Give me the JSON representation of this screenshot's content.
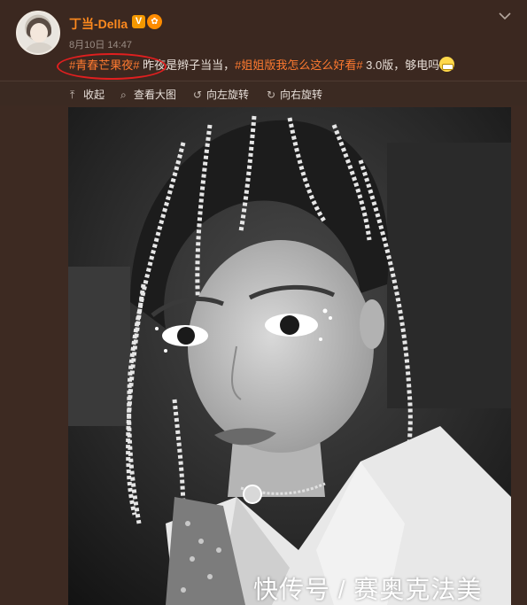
{
  "post": {
    "username": "丁当-Della",
    "verified_badge": "V",
    "time": "8月10日 14:47",
    "hashtag1": "#青春芒果夜#",
    "text1": " 昨夜是辫子当当，",
    "hashtag2": "#姐姐版我怎么这么好看#",
    "text2": " 3.0版，够电吗",
    "emoji": "grin-emoji"
  },
  "toolbar": {
    "collapse": "收起",
    "view_large": "查看大图",
    "rotate_left": "向左旋转",
    "rotate_right": "向右旋转"
  },
  "watermark": "快传号 / 赛奥克法美",
  "colors": {
    "background": "#3d2a22",
    "username": "#ff8a1e",
    "hashtag": "#ff7a30",
    "annotation": "#e01f1f"
  }
}
